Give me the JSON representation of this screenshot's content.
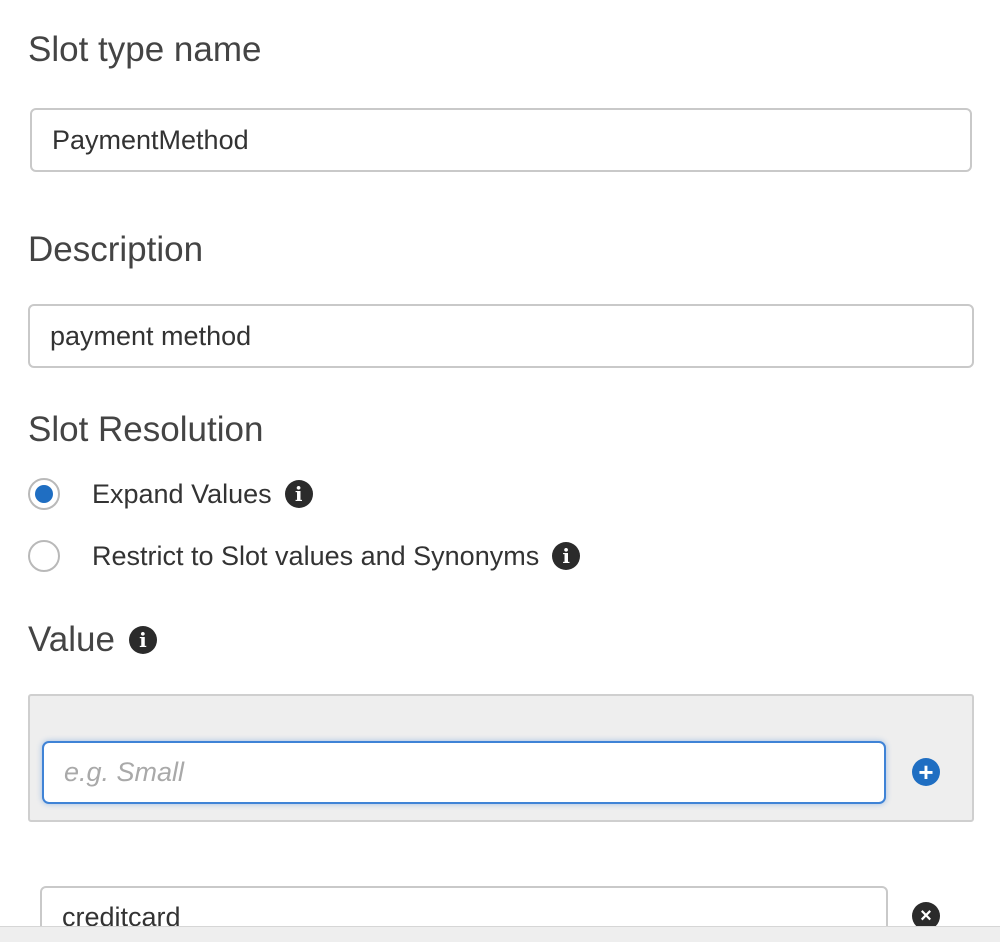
{
  "slot_type_name": {
    "label": "Slot type name",
    "value": "PaymentMethod"
  },
  "description": {
    "label": "Description",
    "value": "payment method"
  },
  "slot_resolution": {
    "label": "Slot Resolution",
    "options": [
      {
        "label": "Expand Values",
        "selected": true,
        "info_icon": "info-icon"
      },
      {
        "label": "Restrict to Slot values and Synonyms",
        "selected": false,
        "info_icon": "info-icon"
      }
    ]
  },
  "value": {
    "label": "Value",
    "info_icon": "info-icon",
    "new_value_placeholder": "e.g. Small",
    "add_icon": "plus-circle-icon",
    "entries": [
      {
        "value": "creditcard",
        "remove_icon": "close-circle-icon"
      }
    ]
  },
  "colors": {
    "accent": "#1f6ec2",
    "focus_border": "#3f83d6",
    "panel_bg": "#eeeeee"
  }
}
